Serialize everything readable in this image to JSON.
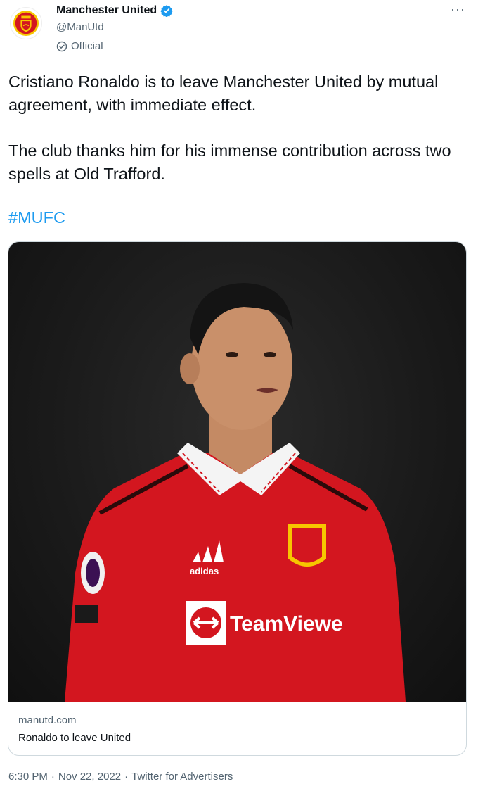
{
  "header": {
    "display_name": "Manchester United",
    "handle": "@ManUtd",
    "label": "Official"
  },
  "tweet": {
    "paragraph1": "Cristiano Ronaldo is to leave Manchester United by mutual agreement, with immediate effect.",
    "paragraph2": "The club thanks him for his immense contribution across two spells at Old Trafford.",
    "hashtag": "#MUFC"
  },
  "card": {
    "domain": "manutd.com",
    "title": "Ronaldo to leave United",
    "image": {
      "sponsor_text": "TeamViewe",
      "kit_brand": "adidas"
    }
  },
  "meta": {
    "time": "6:30 PM",
    "sep1": "·",
    "date": "Nov 22, 2022",
    "sep2": "·",
    "source": "Twitter for Advertisers"
  },
  "colors": {
    "link": "#1d9bf0",
    "verified": "#1d9bf0",
    "jersey": "#d3161f"
  }
}
